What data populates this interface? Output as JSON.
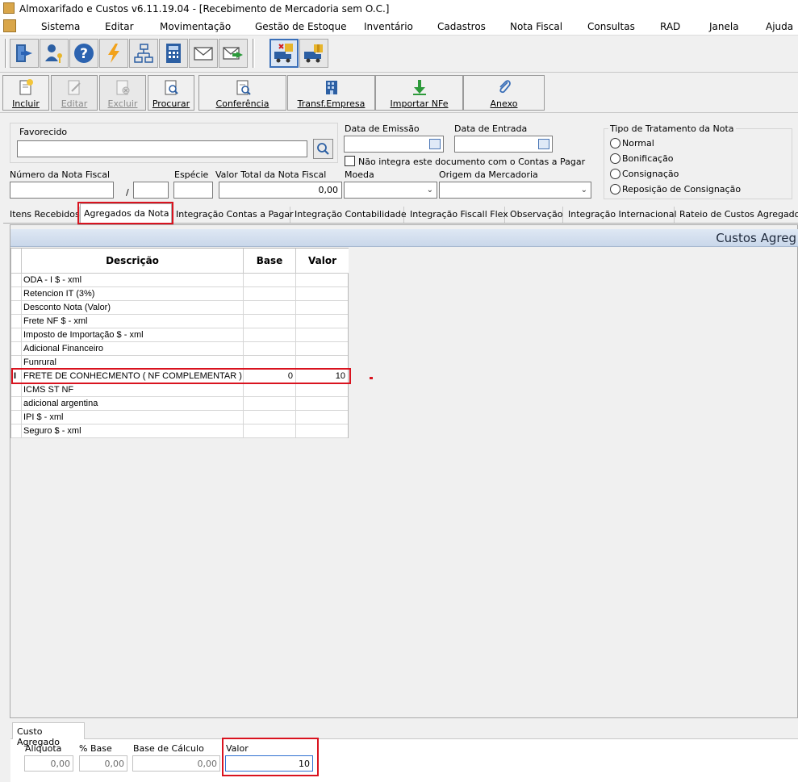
{
  "window": {
    "title": "Almoxarifado e Custos v6.11.19.04 - [Recebimento de Mercadoria sem O.C.]"
  },
  "menu": [
    "Sistema",
    "Editar",
    "Movimentação",
    "Gestão de Estoque",
    "Inventário",
    "Cadastros",
    "Nota Fiscal",
    "Consultas",
    "RAD",
    "Janela",
    "Ajuda"
  ],
  "toolbar_icons": [
    "exit-icon",
    "user-key-icon",
    "help-icon",
    "lightning-icon",
    "org-chart-icon",
    "calculator-icon",
    "mail-icon",
    "mail-send-icon",
    "truck-cancel-icon",
    "truck-box-icon"
  ],
  "actions": {
    "incluir": "Incluir",
    "editar": "Editar",
    "excluir": "Excluir",
    "procurar": "Procurar",
    "conferencia": "Conferência",
    "transf": "Transf.Empresa",
    "importar": "Importar NFe",
    "anexo": "Anexo"
  },
  "form": {
    "favorecido_label": "Favorecido",
    "favorecido_value": "",
    "data_emissao_label": "Data de Emissão",
    "data_emissao_value": "",
    "data_entrada_label": "Data de Entrada",
    "data_entrada_value": "",
    "nao_integra_label": "Não integra este documento com o Contas a Pagar",
    "numero_nf_label": "Número da Nota Fiscal",
    "numero_nf_value": "",
    "serie_sep": "/",
    "serie_value": "",
    "especie_label": "Espécie",
    "especie_value": "",
    "valor_total_label": "Valor Total da Nota Fiscal",
    "valor_total_value": "0,00",
    "moeda_label": "Moeda",
    "moeda_value": "",
    "origem_label": "Origem da Mercadoria",
    "origem_value": ""
  },
  "tratamento": {
    "label": "Tipo de Tratamento da Nota",
    "options": [
      "Normal",
      "Bonificação",
      "Consignação",
      "Reposição de Consignação"
    ]
  },
  "tabs": [
    "Itens Recebidos",
    "Agregados da Nota",
    "Integração Contas a Pagar",
    "Integração Contabilidade",
    "Integração Fiscall Flex",
    "Observação",
    "Integração Internacional",
    "Rateio de Custos Agregado"
  ],
  "active_tab": "Agregados da Nota",
  "panel_title": "Custos Agreg",
  "grid": {
    "headers": [
      "Descrição",
      "Base",
      "Valor"
    ],
    "rows": [
      {
        "descricao": "ODA - I $ - xml",
        "base": "",
        "valor": ""
      },
      {
        "descricao": "Retencion IT (3%)",
        "base": "",
        "valor": ""
      },
      {
        "descricao": "Desconto Nota (Valor)",
        "base": "",
        "valor": ""
      },
      {
        "descricao": "Frete NF $ - xml",
        "base": "",
        "valor": ""
      },
      {
        "descricao": "Imposto de Importação $ - xml",
        "base": "",
        "valor": ""
      },
      {
        "descricao": "Adicional Financeiro",
        "base": "",
        "valor": ""
      },
      {
        "descricao": "Funrural",
        "base": "",
        "valor": ""
      },
      {
        "descricao": "FRETE DE CONHECMENTO ( NF COMPLEMENTAR )",
        "base": "0",
        "valor": "10"
      },
      {
        "descricao": "ICMS ST NF",
        "base": "",
        "valor": ""
      },
      {
        "descricao": "adicional argentina",
        "base": "",
        "valor": ""
      },
      {
        "descricao": "IPI $ - xml",
        "base": "",
        "valor": ""
      },
      {
        "descricao": "Seguro $ - xml",
        "base": "",
        "valor": ""
      }
    ]
  },
  "bottom": {
    "tab": "Custo Agregado",
    "aliquota_label": "Alíquota",
    "aliquota_value": "0,00",
    "pbase_label": "% Base",
    "pbase_value": "0,00",
    "base_calc_label": "Base de Cálculo",
    "base_calc_value": "0,00",
    "valor_label": "Valor",
    "valor_value": "10"
  }
}
